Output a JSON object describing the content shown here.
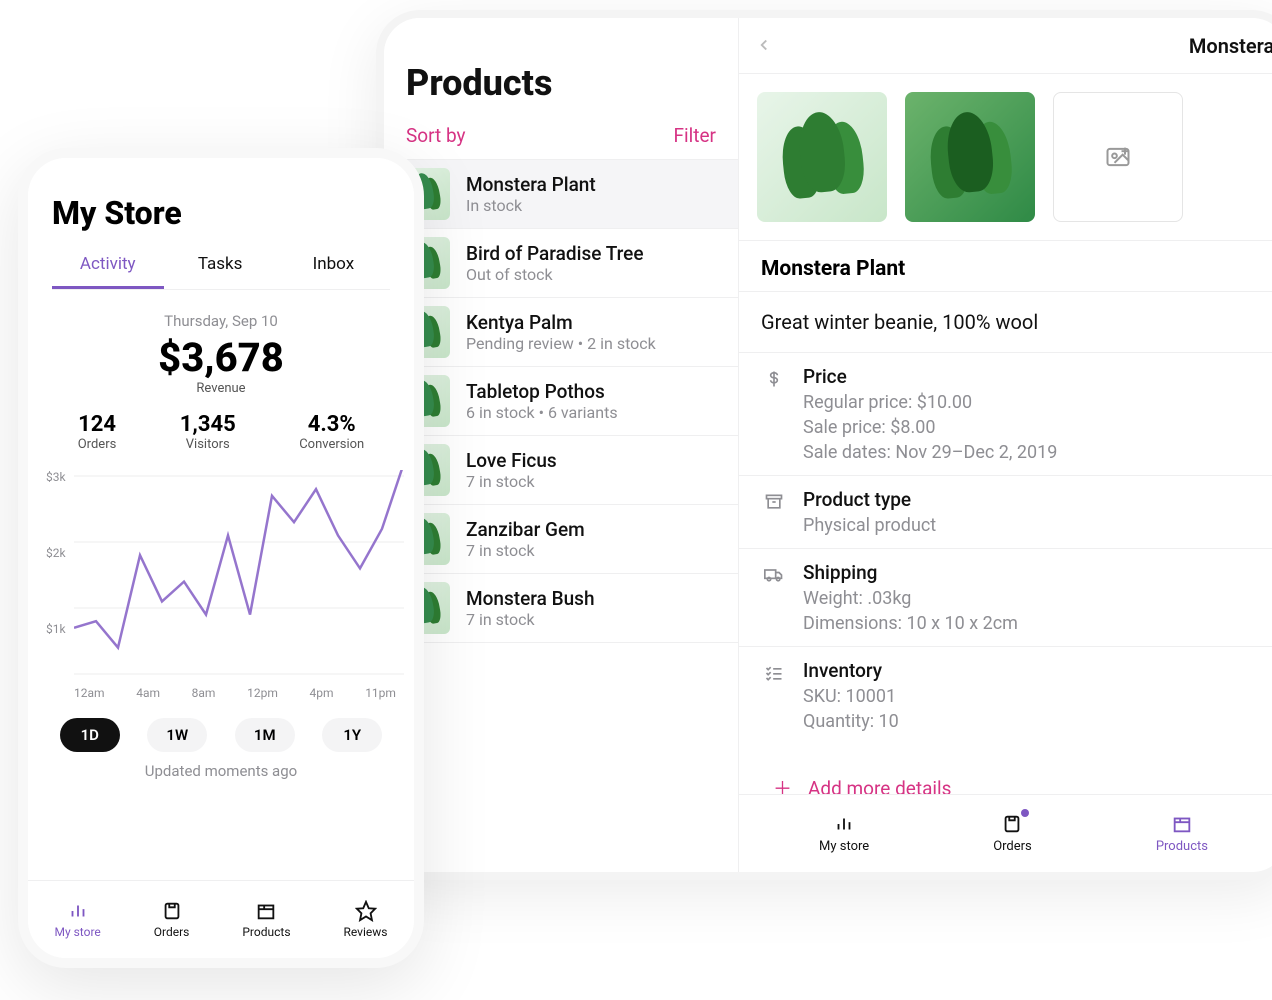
{
  "colors": {
    "accent": "#7e57c2",
    "magenta": "#d63384"
  },
  "tablet": {
    "products_title": "Products",
    "sort_label": "Sort by",
    "filter_label": "Filter",
    "items": [
      {
        "name": "Monstera Plant",
        "sub": "In stock"
      },
      {
        "name": "Bird of Paradise Tree",
        "sub": "Out of stock"
      },
      {
        "name": "Kentya Palm",
        "sub": "Pending review • 2 in stock"
      },
      {
        "name": "Tabletop Pothos",
        "sub": "6 in stock • 6 variants"
      },
      {
        "name": "Love Ficus",
        "sub": "7 in stock"
      },
      {
        "name": "Zanzibar Gem",
        "sub": "7 in stock"
      },
      {
        "name": "Monstera Bush",
        "sub": "7 in stock"
      }
    ],
    "detail": {
      "breadcrumb": "Monstera Pla",
      "name": "Monstera Plant",
      "description": "Great winter beanie, 100% wool",
      "price": {
        "label": "Price",
        "regular": "Regular price: $10.00",
        "sale": "Sale price: $8.00",
        "dates": "Sale dates: Nov 29–Dec 2, 2019"
      },
      "type": {
        "label": "Product type",
        "value": "Physical product"
      },
      "shipping": {
        "label": "Shipping",
        "weight": "Weight: .03kg",
        "dimensions": "Dimensions: 10 x 10 x 2cm"
      },
      "inventory": {
        "label": "Inventory",
        "sku": "SKU: 10001",
        "qty": "Quantity: 10"
      },
      "add_more": "Add more details"
    },
    "tabbar": {
      "mystore": "My store",
      "orders": "Orders",
      "products": "Products"
    }
  },
  "phone": {
    "title": "My Store",
    "tabs": {
      "activity": "Activity",
      "tasks": "Tasks",
      "inbox": "Inbox"
    },
    "date": "Thursday, Sep 10",
    "big_value": "$3,678",
    "big_label": "Revenue",
    "stats": [
      {
        "value": "124",
        "label": "Orders"
      },
      {
        "value": "1,345",
        "label": "Visitors"
      },
      {
        "value": "4.3%",
        "label": "Conversion"
      }
    ],
    "ranges": [
      "1D",
      "1W",
      "1M",
      "1Y"
    ],
    "updated": "Updated moments ago",
    "tabbar": {
      "mystore": "My store",
      "orders": "Orders",
      "products": "Products",
      "reviews": "Reviews"
    }
  },
  "chart_data": {
    "type": "line",
    "ylabel": "",
    "xlabel": "",
    "ylim": [
      0,
      3000
    ],
    "yticks": [
      "$3k",
      "$2k",
      "$1k"
    ],
    "categories": [
      "12am",
      "4am",
      "8am",
      "12pm",
      "4pm",
      "11pm"
    ],
    "x": [
      0,
      1,
      2,
      3,
      4,
      5,
      6,
      7,
      8,
      9,
      10,
      11,
      12,
      13,
      14,
      15
    ],
    "values": [
      700,
      800,
      400,
      1800,
      1100,
      1400,
      900,
      2100,
      900,
      2700,
      2300,
      2800,
      2100,
      1600,
      2200,
      3200
    ]
  }
}
